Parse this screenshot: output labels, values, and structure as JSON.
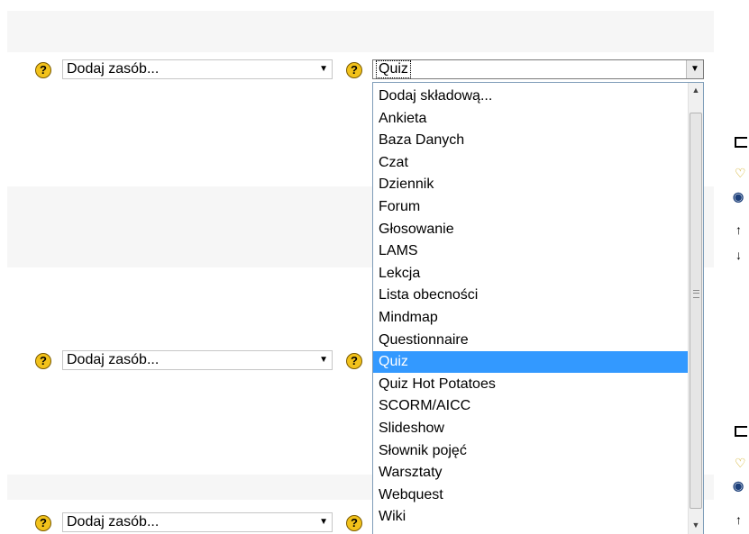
{
  "add_resource": {
    "label": "Dodaj zasób..."
  },
  "add_activity": {
    "selected": "Quiz",
    "options": [
      "Dodaj składową...",
      "Ankieta",
      "Baza Danych",
      "Czat",
      "Dziennik",
      "Forum",
      "Głosowanie",
      "LAMS",
      "Lekcja",
      "Lista obecności",
      "Mindmap",
      "Questionnaire",
      "Quiz",
      "Quiz Hot Potatoes",
      "SCORM/AICC",
      "Slideshow",
      "Słownik pojęć",
      "Warsztaty",
      "Webquest",
      "Wiki"
    ],
    "highlighted_index": 12
  },
  "help": {
    "glyph": "?"
  },
  "icons": {
    "checkbox": "checkbox-icon",
    "lightbulb": "lightbulb-icon",
    "eye": "eye-icon",
    "arrow_up": "arrow-up-icon",
    "arrow_down": "arrow-down-icon",
    "dropdown_arrow": "chevron-down-icon"
  },
  "colors": {
    "highlight": "#3399ff",
    "help_icon": "#f2c21b",
    "row_band": "#f6f6f6"
  }
}
